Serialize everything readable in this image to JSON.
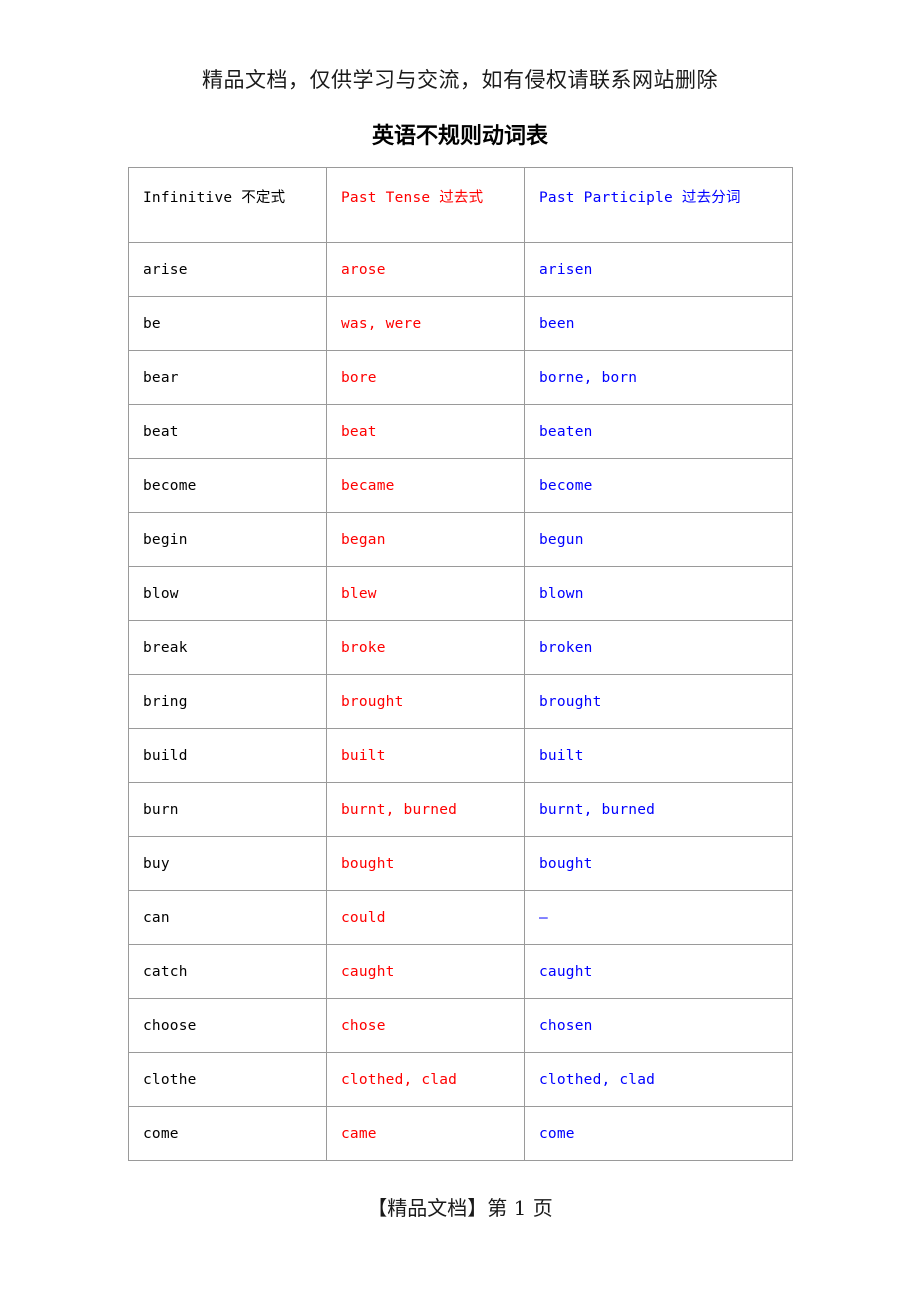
{
  "header": {
    "notice": "精品文档，仅供学习与交流，如有侵权请联系网站删除"
  },
  "title": "英语不规则动词表",
  "footer": {
    "text": "【精品文档】第 1 页"
  },
  "colors": {
    "infinitive": "#000000",
    "past_tense": "#ff0000",
    "past_participle": "#0000ff",
    "table_border": "#9a9a9a",
    "page_background": "#ffffff"
  },
  "table": {
    "columns": [
      {
        "label": "Infinitive 不定式",
        "color_key": "infinitive"
      },
      {
        "label": "Past Tense 过去式",
        "color_key": "past_tense"
      },
      {
        "label": "Past Participle 过去分词",
        "color_key": "past_participle"
      }
    ],
    "rows": [
      {
        "infinitive": "arise",
        "past": "arose",
        "participle": "arisen"
      },
      {
        "infinitive": "be",
        "past": "was, were",
        "participle": "been"
      },
      {
        "infinitive": "bear",
        "past": "bore",
        "participle": "borne, born"
      },
      {
        "infinitive": "beat",
        "past": "beat",
        "participle": "beaten"
      },
      {
        "infinitive": "become",
        "past": "became",
        "participle": "become"
      },
      {
        "infinitive": "begin",
        "past": "began",
        "participle": "begun"
      },
      {
        "infinitive": "blow",
        "past": "blew",
        "participle": "blown"
      },
      {
        "infinitive": "break",
        "past": "broke",
        "participle": "broken"
      },
      {
        "infinitive": "bring",
        "past": "brought",
        "participle": "brought"
      },
      {
        "infinitive": "build",
        "past": "built",
        "participle": "built"
      },
      {
        "infinitive": "burn",
        "past": "burnt, burned",
        "participle": "burnt, burned"
      },
      {
        "infinitive": "buy",
        "past": "bought",
        "participle": "bought"
      },
      {
        "infinitive": "can",
        "past": "could",
        "participle": "–"
      },
      {
        "infinitive": "catch",
        "past": "caught",
        "participle": "caught"
      },
      {
        "infinitive": "choose",
        "past": "chose",
        "participle": "chosen"
      },
      {
        "infinitive": "clothe",
        "past": "clothed, clad",
        "participle": "clothed, clad"
      },
      {
        "infinitive": "come",
        "past": "came",
        "participle": "come"
      }
    ]
  }
}
